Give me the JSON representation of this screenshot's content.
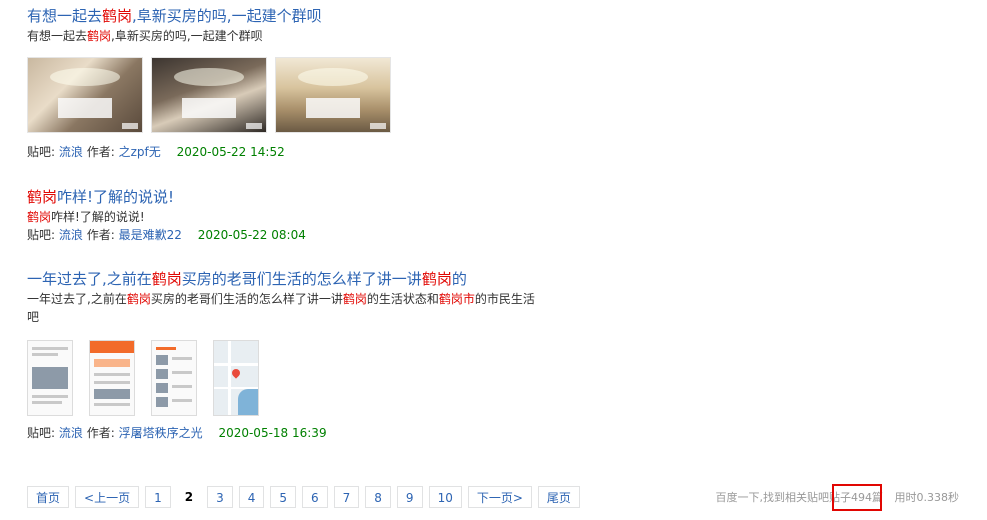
{
  "posts": [
    {
      "title_parts": [
        "有想一起去",
        "鹤岗",
        ",阜新买房的吗,一起建个群呗"
      ],
      "snippet_parts": [
        "有想一起去",
        "鹤岗",
        ",阜新买房的吗,一起建个群呗"
      ],
      "bar_label": "贴吧:",
      "bar_name": "流浪",
      "author_label": "作者:",
      "author": "之zpf无",
      "date": "2020-05-22 14:52"
    },
    {
      "title_parts": [
        "鹤岗",
        "咋样!了解的说说!"
      ],
      "snippet_parts": [
        "鹤岗",
        "咋样!了解的说说!"
      ],
      "bar_label": "贴吧:",
      "bar_name": "流浪",
      "author_label": "作者:",
      "author": "最是难歉22",
      "date": "2020-05-22 08:04"
    },
    {
      "title_parts": [
        "一年过去了,之前在",
        "鹤岗",
        "买房的老哥们生活的怎么样了讲一讲",
        "鹤岗",
        "的"
      ],
      "snippet_parts": [
        "一年过去了,之前在",
        "鹤岗",
        "买房的老哥们生活的怎么样了讲一讲",
        "鹤岗",
        "的生活状态和",
        "鹤岗市",
        "的市民生活吧"
      ],
      "bar_label": "贴吧:",
      "bar_name": "流浪",
      "author_label": "作者:",
      "author": "浮屠塔秩序之光",
      "date": "2020-05-18 16:39"
    }
  ],
  "pager": {
    "first": "首页",
    "prev": "<上一页",
    "pages": [
      "1",
      "2",
      "3",
      "4",
      "5",
      "6",
      "7",
      "8",
      "9",
      "10"
    ],
    "current": "2",
    "next": "下一页>",
    "last": "尾页"
  },
  "stats": {
    "prefix": "百度一下,找到相关贴吧贴子",
    "count": "494篇",
    "time": "用时0.338秒"
  },
  "colors": {
    "link": "#2d64b3",
    "highlight": "#e10602",
    "date": "#008000",
    "annotation_box": "#e10602"
  }
}
